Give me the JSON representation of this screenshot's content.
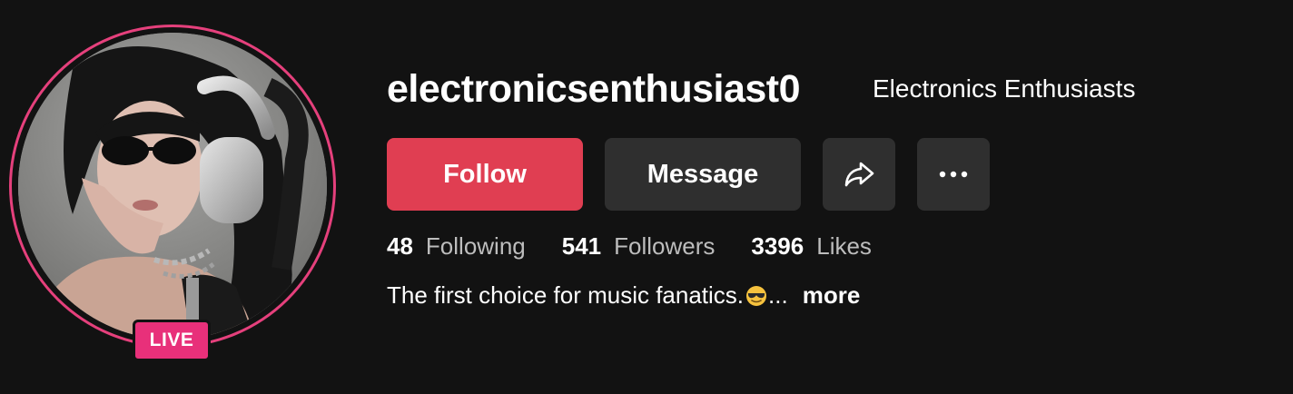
{
  "profile": {
    "username": "electronicsenthusiast0",
    "display_name": "Electronics Enthusiasts",
    "live_badge": "LIVE"
  },
  "actions": {
    "follow_label": "Follow",
    "message_label": "Message",
    "share_icon": "share-arrow-icon",
    "more_icon": "ellipsis-icon"
  },
  "stats": [
    {
      "value": "48",
      "label": "Following"
    },
    {
      "value": "541",
      "label": "Followers"
    },
    {
      "value": "3396",
      "label": "Likes"
    }
  ],
  "bio": {
    "text": "The first choice for music fanatics.",
    "emoji": "smiling-face-with-sunglasses",
    "ellipsis": "...",
    "more_label": "more"
  },
  "colors": {
    "background": "#121212",
    "follow_button": "#e03e52",
    "secondary_button": "#2f2f2f",
    "live_badge": "#e8307a",
    "avatar_ring": "#e5407c"
  }
}
